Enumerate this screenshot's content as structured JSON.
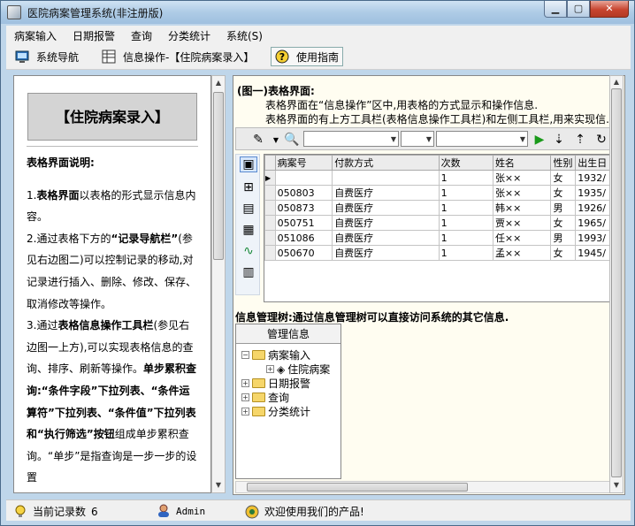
{
  "window": {
    "title": "医院病案管理系统(非注册版)"
  },
  "menu": [
    "病案输入",
    "日期报警",
    "查询",
    "分类统计",
    "系统(S)"
  ],
  "toolbar": {
    "nav": "系统导航",
    "info": "信息操作-【住院病案录入】",
    "help": "使用指南"
  },
  "left": {
    "heading": "【住院病案录入】",
    "section_title": "表格界面说明:",
    "p1_bold": "表格界面",
    "p1_rest": "以表格的形式显示信息内容。",
    "p2_a": "2.通过表格下方的",
    "p2_b": "“记录导航栏”",
    "p2_c": "(参见右边图二)可以控制记录的移动,对记录进行插入、删除、修改、保存、取消修改等操作。",
    "p3_a": "3.通过",
    "p3_b": "表格信息操作工具栏",
    "p3_c": "(参见右边图一上方),可以实现表格信息的查询、排序、刷新等操作。",
    "p3_d": "单步累积查询:“条件字段”下拉列表、“条件运算符”下拉列表、“条件值”下拉列表和“执行筛选”按钮",
    "p3_e": "组成单步累积查询。“单步”是指查询是一步一步的设置"
  },
  "right": {
    "title": "(图一)表格界面:",
    "line1": "表格界面在“信息操作”区中,用表格的方式显示和操作信息.",
    "line2": "表格界面的有上方工具栏(表格信息操作工具栏)和左侧工具栏,用来实现信.",
    "table": {
      "columns": [
        "病案号",
        "付款方式",
        "次数",
        "姓名",
        "性别",
        "出生日"
      ],
      "rows": [
        [
          "",
          "",
          "1",
          "张××",
          "女",
          "1932/"
        ],
        [
          "050803",
          "自费医疗",
          "1",
          "张××",
          "女",
          "1935/"
        ],
        [
          "050873",
          "自费医疗",
          "1",
          "韩××",
          "男",
          "1926/"
        ],
        [
          "050751",
          "自费医疗",
          "1",
          "贾××",
          "女",
          "1965/"
        ],
        [
          "051086",
          "自费医疗",
          "1",
          "任××",
          "男",
          "1993/"
        ],
        [
          "050670",
          "自费医疗",
          "1",
          "孟××",
          "女",
          "1945/"
        ]
      ]
    },
    "tree_title": "信息管理树:通过信息管理树可以直接访问系统的其它信息.",
    "tree": {
      "header": "管理信息",
      "nodes": [
        "病案输入",
        "住院病案",
        "日期报警",
        "查询",
        "分类统计"
      ]
    }
  },
  "status": {
    "records_label": "当前记录数",
    "records_count": "6",
    "user": "Admin",
    "message": "欢迎使用我们的产品!"
  }
}
